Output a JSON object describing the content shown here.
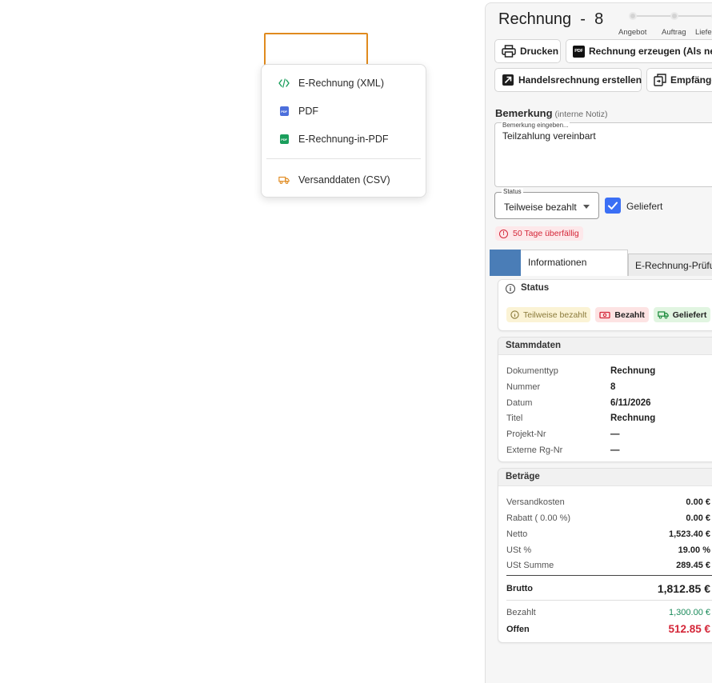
{
  "menu": {
    "items": [
      {
        "label": "E-Rechnung (XML)",
        "icon": "code-icon"
      },
      {
        "label": "PDF",
        "icon": "pdf-file-icon"
      },
      {
        "label": "E-Rechnung-in-PDF",
        "icon": "pdf-green-icon"
      },
      {
        "label": "Versanddaten (CSV)",
        "icon": "truck-icon"
      }
    ]
  },
  "document": {
    "title": "Rechnung  -  8",
    "steps": [
      "Angebot",
      "Auftrag",
      "Liefe"
    ]
  },
  "actions": {
    "print": "Drucken",
    "create_invoice": "Rechnung erzeugen (Als neu",
    "trade_invoice": "Handelsrechnung erstellen",
    "recipients": "Empfänge",
    "pdf_chip": "PDF"
  },
  "remark": {
    "label": "Bemerkung",
    "sub_label": "(interne Notiz)",
    "placeholder": "Bemerkung eingeben...",
    "value": "Teilzahlung vereinbart"
  },
  "status": {
    "label": "Status",
    "value": "Teilweise bezahlt",
    "delivered_label": "Geliefert",
    "delivered_checked": true,
    "overdue": "50 Tage überfällig"
  },
  "tabs": {
    "active": "Informationen",
    "other": "E-Rechnung-Prüfu"
  },
  "status_card": {
    "title": "Status",
    "badges": [
      {
        "label": "Teilweise bezahlt",
        "color": "#8a7a3a",
        "bg": "#fbf3d5"
      },
      {
        "label": "Bezahlt",
        "color": "#222222",
        "bg": "#fde3e3"
      },
      {
        "label": "Geliefert",
        "color": "#222222",
        "bg": "#e1f5e1"
      }
    ]
  },
  "stammdaten": {
    "title": "Stammdaten",
    "rows": [
      {
        "key": "Dokumenttyp",
        "value": "Rechnung"
      },
      {
        "key": "Nummer",
        "value": "8"
      },
      {
        "key": "Datum",
        "value": "6/11/2026"
      },
      {
        "key": "Titel",
        "value": "Rechnung"
      },
      {
        "key": "Projekt-Nr",
        "value": "—"
      },
      {
        "key": "Externe Rg-Nr",
        "value": "—"
      }
    ]
  },
  "betraege": {
    "title": "Beträge",
    "versandkosten": {
      "key": "Versandkosten",
      "value": "0.00 €"
    },
    "rabatt": {
      "key": "Rabatt  ( 0.00  %)",
      "value": "0.00 €"
    },
    "netto": {
      "key": "Netto",
      "value": "1,523.40 €"
    },
    "ust_pct": {
      "key": "USt %",
      "value": "19.00 %"
    },
    "ust_sum": {
      "key": "USt Summe",
      "value": "289.45 €"
    },
    "brutto": {
      "key": "Brutto",
      "value": "1,812.85 €"
    },
    "bezahlt": {
      "key": "Bezahlt",
      "value": "1,300.00 €"
    },
    "offen": {
      "key": "Offen",
      "value": "512.85 €"
    }
  },
  "colors": {
    "accent": "#3b6ff5",
    "highlight": "#e08a1e",
    "paid_green": "#1a8a5a",
    "open_red": "#d42638",
    "tab_blue": "#4a7db7"
  }
}
